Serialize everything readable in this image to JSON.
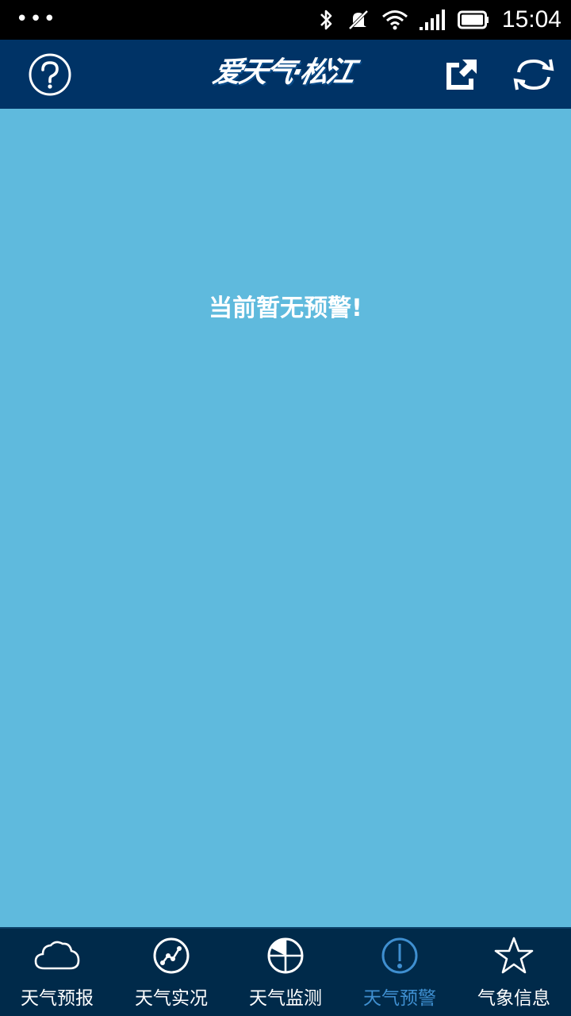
{
  "status_bar": {
    "time": "15:04"
  },
  "header": {
    "logo_text": "爱天气·松江",
    "icons": [
      "help-icon",
      "share-icon",
      "refresh-icon"
    ]
  },
  "main": {
    "empty_message": "当前暂无预警!"
  },
  "bottom_nav": {
    "items": [
      {
        "label": "天气预报",
        "icon": "cloud-icon",
        "active": false
      },
      {
        "label": "天气实况",
        "icon": "trend-icon",
        "active": false
      },
      {
        "label": "天气监测",
        "icon": "radar-icon",
        "active": false
      },
      {
        "label": "天气预警",
        "icon": "alert-icon",
        "active": true
      },
      {
        "label": "气象信息",
        "icon": "star-icon",
        "active": false
      }
    ]
  },
  "colors": {
    "header_bg": "#003366",
    "main_bg": "#5fbadd",
    "nav_bg": "#002a4a",
    "active": "#3f8fd0",
    "text": "#ffffff"
  }
}
